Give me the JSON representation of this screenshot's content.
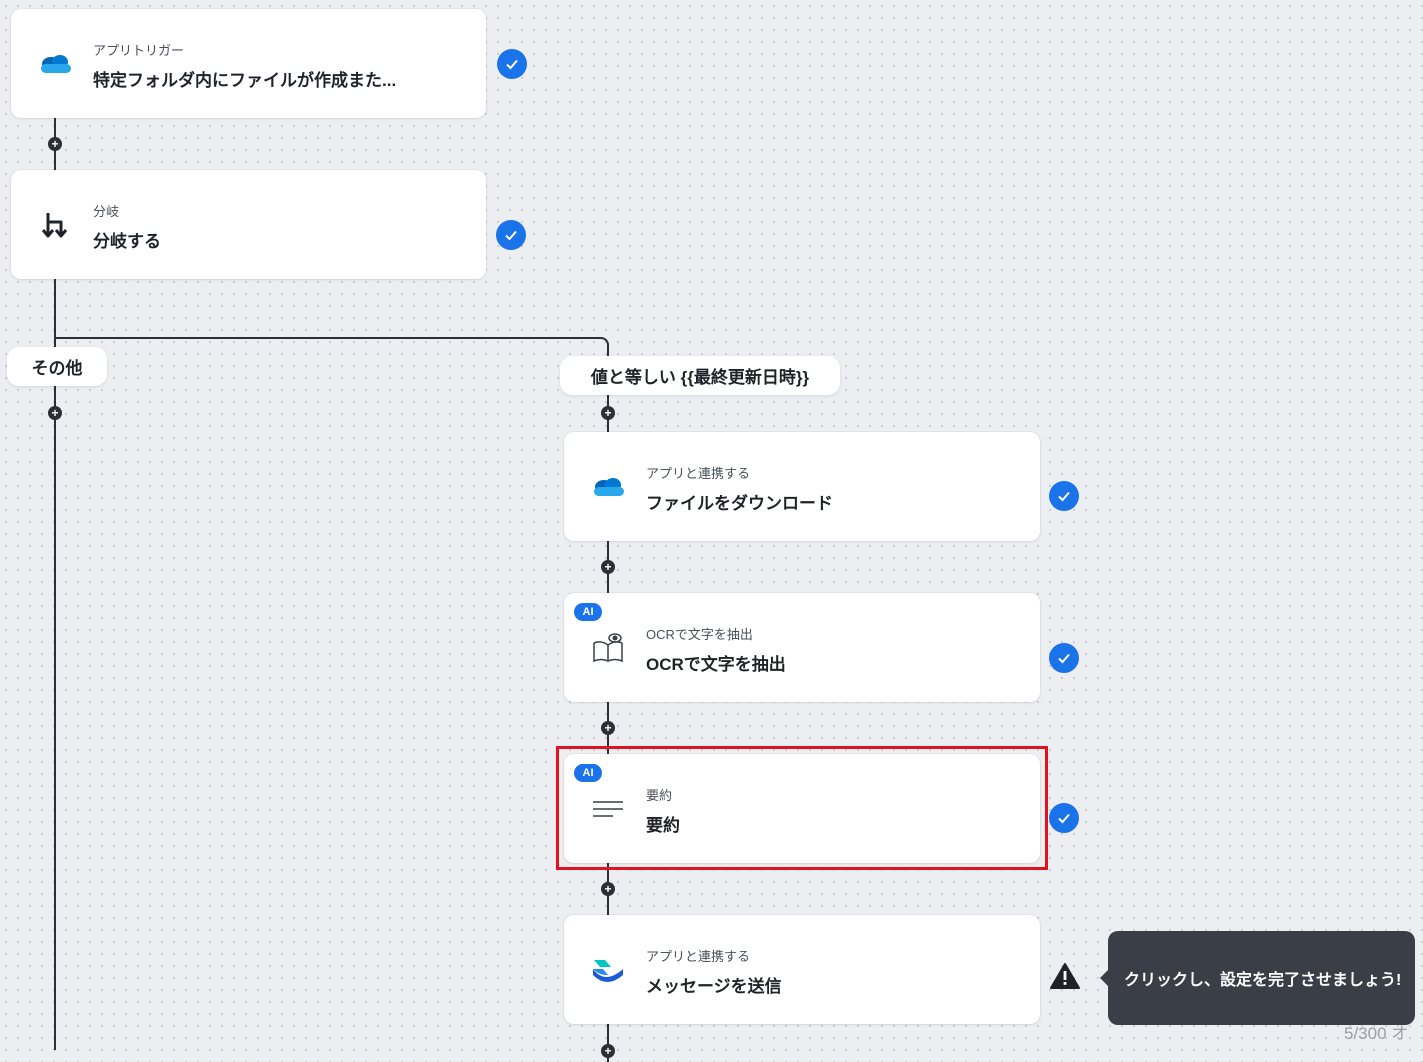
{
  "steps": {
    "trigger": {
      "sub": "アプリトリガー",
      "title": "特定フォルダ内にファイルが作成また...",
      "icon": "onedrive-icon"
    },
    "branch": {
      "sub": "分岐",
      "title": "分岐する",
      "icon": "branch-icon"
    },
    "download": {
      "sub": "アプリと連携する",
      "title": "ファイルをダウンロード",
      "icon": "onedrive-icon"
    },
    "ocr": {
      "badge": "AI",
      "sub": "OCRで文字を抽出",
      "title": "OCRで文字を抽出",
      "icon": "book-eye-icon"
    },
    "summary": {
      "badge": "AI",
      "sub": "要約",
      "title": "要約",
      "icon": "text-lines-icon"
    },
    "message": {
      "sub": "アプリと連携する",
      "title": "メッセージを送信",
      "icon": "chatwork-icon"
    }
  },
  "branches": {
    "other_label": "その他",
    "condition_label": "値と等しい {{最終更新日時}}"
  },
  "tooltip": {
    "text": "クリックし、設定を完了させましょう!"
  },
  "quota": {
    "text": "5/300 オ"
  },
  "colors": {
    "accent": "#1a73e8",
    "highlight": "#e0141e",
    "warning": "#1f2328"
  }
}
